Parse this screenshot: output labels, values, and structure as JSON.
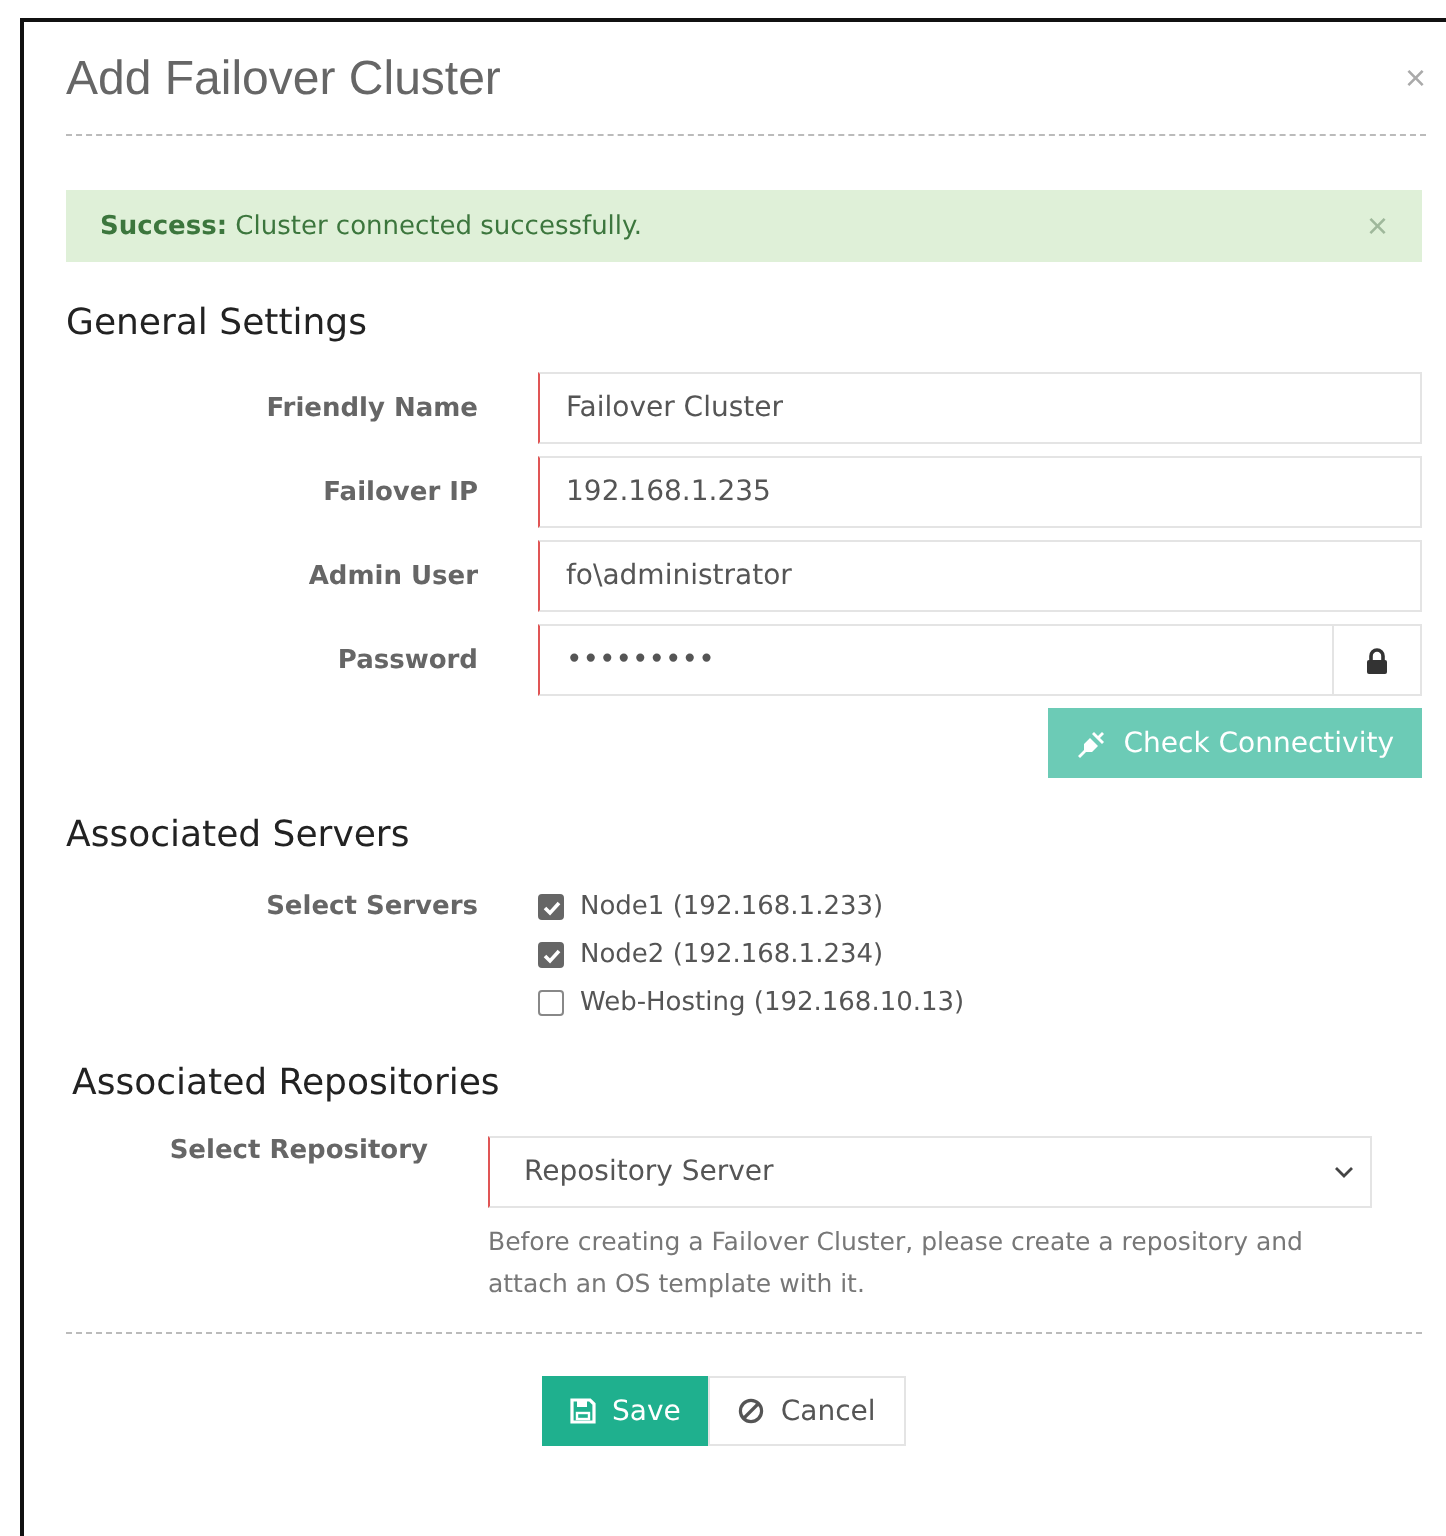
{
  "dialog": {
    "title": "Add Failover Cluster",
    "close": "×"
  },
  "alert": {
    "label": "Success:",
    "message": "Cluster connected successfully.",
    "close": "×"
  },
  "general": {
    "heading": "General Settings",
    "fields": [
      {
        "label": "Friendly Name",
        "kind": "text",
        "value": "Failover Cluster"
      },
      {
        "label": "Failover IP",
        "kind": "text",
        "value": "192.168.1.235"
      },
      {
        "label": "Admin User",
        "kind": "text",
        "value": "fo\\administrator"
      },
      {
        "label": "Password",
        "kind": "password",
        "value": "•••••••••"
      }
    ],
    "check_button": "Check Connectivity"
  },
  "servers": {
    "heading": "Associated Servers",
    "label": "Select Servers",
    "options": [
      {
        "label": "Node1 (192.168.1.233)",
        "checked": true
      },
      {
        "label": "Node2 (192.168.1.234)",
        "checked": true
      },
      {
        "label": "Web-Hosting (192.168.10.13)",
        "checked": false
      }
    ]
  },
  "repositories": {
    "heading": "Associated Repositories",
    "label": "Select Repository",
    "value": "Repository Server",
    "help": "Before creating a Failover Cluster, please create a repository and attach an OS template with it."
  },
  "buttons": {
    "save": "Save",
    "cancel": "Cancel"
  }
}
